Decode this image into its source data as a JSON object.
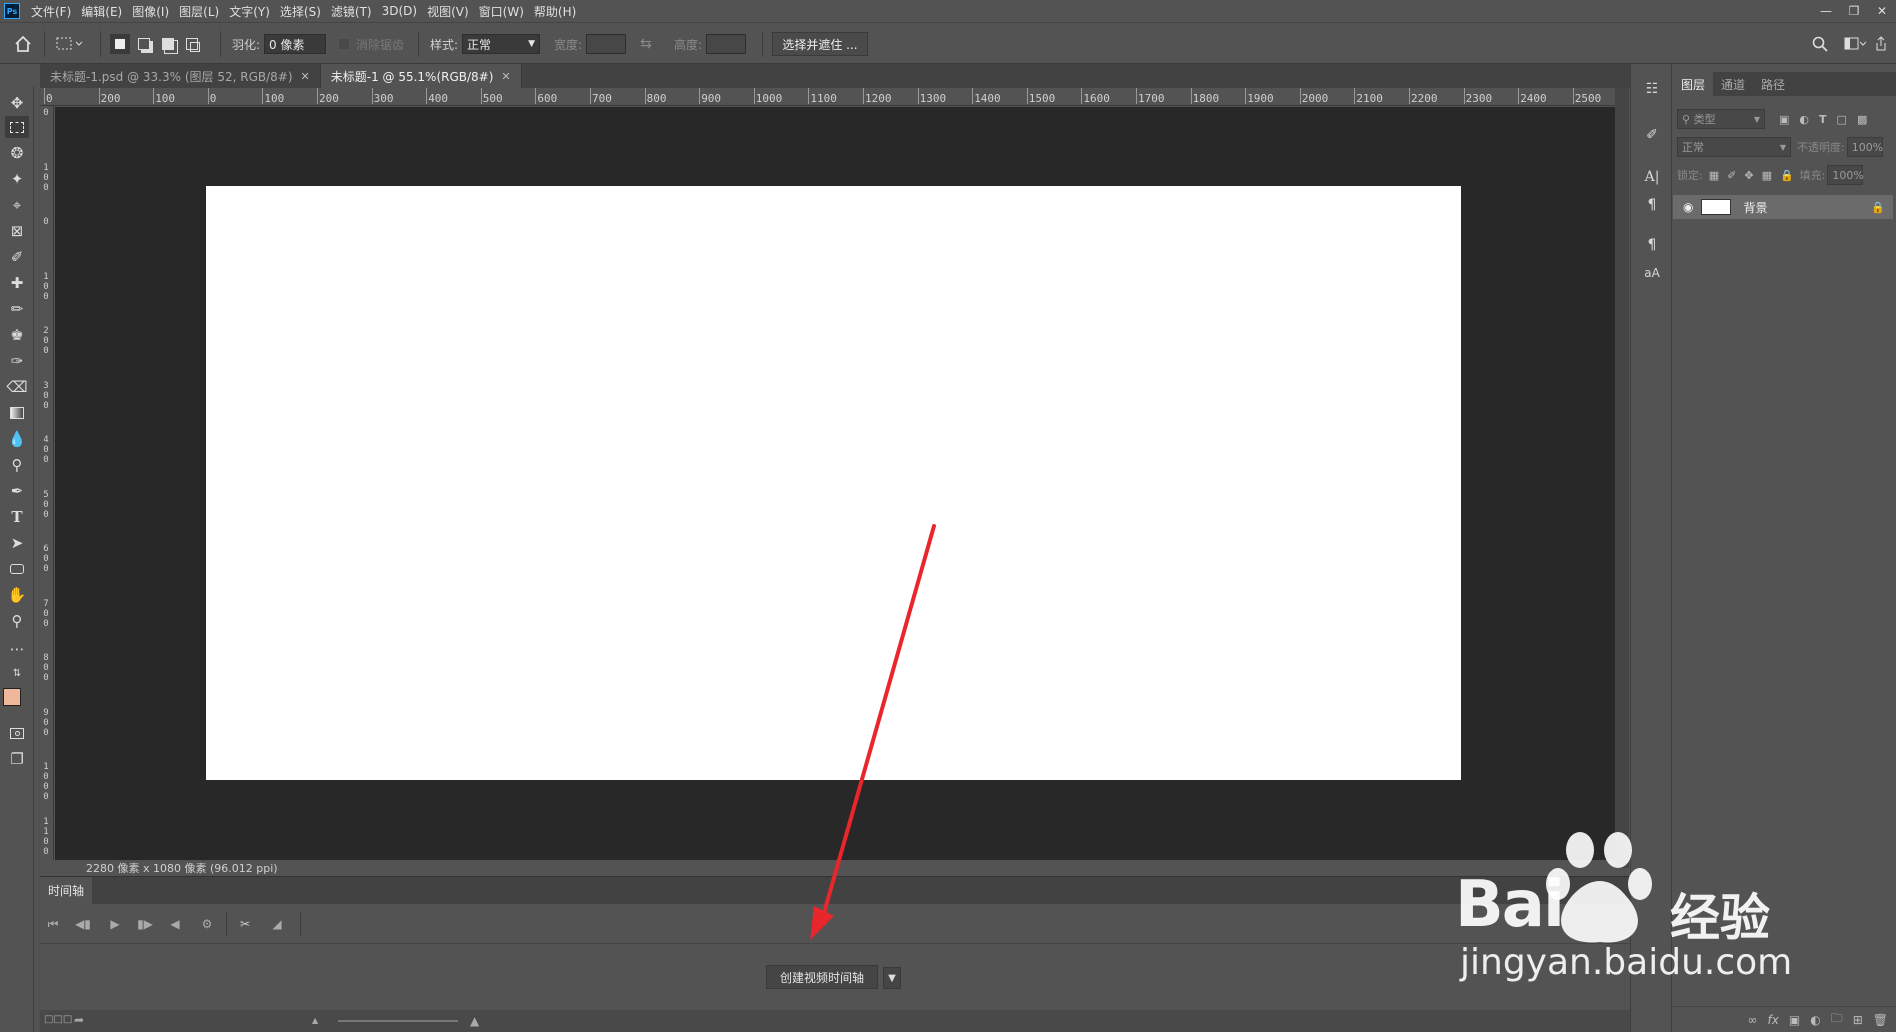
{
  "app": {
    "logo": "Ps",
    "menu": [
      "文件(F)",
      "编辑(E)",
      "图像(I)",
      "图层(L)",
      "文字(Y)",
      "选择(S)",
      "滤镜(T)",
      "3D(D)",
      "视图(V)",
      "窗口(W)",
      "帮助(H)"
    ],
    "window_controls": [
      "minimize-icon",
      "restore-icon",
      "close-icon"
    ]
  },
  "options": {
    "feather_label": "羽化:",
    "feather_value": "0 像素",
    "antialias_label": "消除锯齿",
    "style_label": "样式:",
    "style_value": "正常",
    "width_label": "宽度:",
    "height_label": "高度:",
    "select_mask_button": "选择并遮住 ..."
  },
  "tabs": [
    {
      "label": "未标题-1.psd @ 33.3% (图层 52, RGB/8#)",
      "active": false
    },
    {
      "label": "未标题-1 @ 55.1%(RGB/8#)",
      "active": true
    }
  ],
  "ruler": {
    "top": [
      "0",
      "200",
      "100",
      "0",
      "100",
      "200",
      "300",
      "400",
      "500",
      "600",
      "700",
      "800",
      "900",
      "1000",
      "1100",
      "1200",
      "1300",
      "1400",
      "1500",
      "1600",
      "1700",
      "1800",
      "1900",
      "2000",
      "2100",
      "2200",
      "2300",
      "2400",
      "2500"
    ],
    "left": [
      "0",
      "1 0 0",
      "0",
      "1 0 0",
      "2 0 0",
      "3 0 0",
      "4 0 0",
      "5 0 0",
      "6 0 0",
      "7 0 0",
      "8 0 0",
      "9 0 0",
      "1 0 0 0",
      "1 1 0 0",
      "1"
    ]
  },
  "status": {
    "doc_info": "2280 像素 x 1080 像素 (96.012 ppi)"
  },
  "timeline": {
    "tab_label": "时间轴",
    "create_button": "创建视频时间轴",
    "controls": [
      "first-frame-icon",
      "prev-frame-icon",
      "play-icon",
      "next-frame-icon",
      "audio-icon",
      "settings-icon",
      "scissors-icon",
      "transition-icon"
    ]
  },
  "layers": {
    "tabs": [
      "图层",
      "通道",
      "路径"
    ],
    "filter_placeholder": "类型",
    "blend_mode": "正常",
    "opacity_label": "不透明度:",
    "opacity_value": "100%",
    "lock_label": "锁定:",
    "fill_label": "填充:",
    "fill_value": "100%",
    "items": [
      {
        "name": "背景",
        "visible": true,
        "locked": true
      }
    ]
  },
  "watermark": {
    "brand": "Bai",
    "brand_cn": "经验",
    "url": "jingyan.baidu.com"
  },
  "colors": {
    "foreground": "#f0b89a",
    "background": "#ffffff",
    "annotation_arrow": "#e8262b"
  }
}
